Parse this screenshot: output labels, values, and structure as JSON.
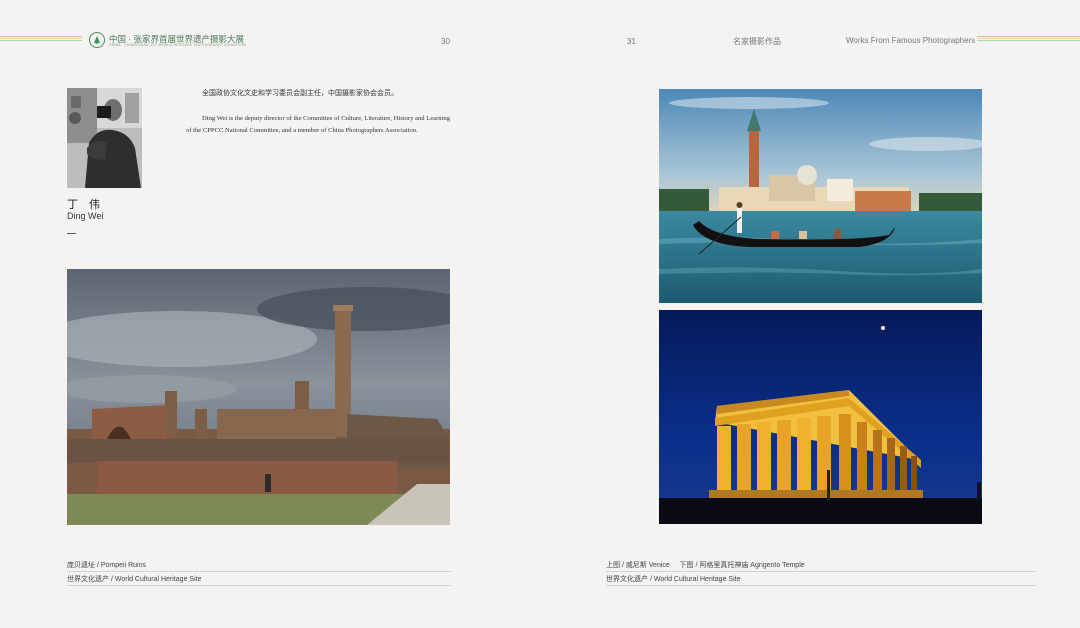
{
  "header": {
    "brand_title": "中国 · 张家界首届世界遗产摄影大展",
    "brand_subtitle": "CHINA · ZHANGJIAJIE 1ST WORLD HERITAGE PHOTOGRAPHY EXHIBITION",
    "page_left": "30",
    "page_right": "31",
    "section_cn": "名家摄影作品",
    "section_en": "Works From Famous Photographers",
    "stripe_colors": [
      "#e8b0a8",
      "#f0d890",
      "#a8d8b0",
      "#a8c8e8"
    ]
  },
  "author": {
    "name_cn": "丁 伟",
    "name_en": "Ding Wei",
    "bio_cn": "全国政协文化文史和学习委员会副主任，中国摄影家协会会员。",
    "bio_en": "Ding Wei is the deputy director of the Committee of Culture, Literature, History and Learning of the CPPCC National Committee, and a member of China Photographers Association."
  },
  "captions": {
    "left_title": "庞贝遗址 / Pompeii Ruins",
    "left_subtitle": "世界文化遗产 / World Cultural Heritage Site",
    "right_title": "上图 / 威尼斯 Venice     下图 / 阿格里真托神庙 Agrigento Temple",
    "right_subtitle": "世界文化遗产 / World Cultural Heritage Site"
  },
  "colors": {
    "brand_green": "#3f8e5a",
    "night_sky": "#0a2f8a",
    "temple_gold": "#e0a020",
    "lagoon": "#3a8aa0"
  }
}
